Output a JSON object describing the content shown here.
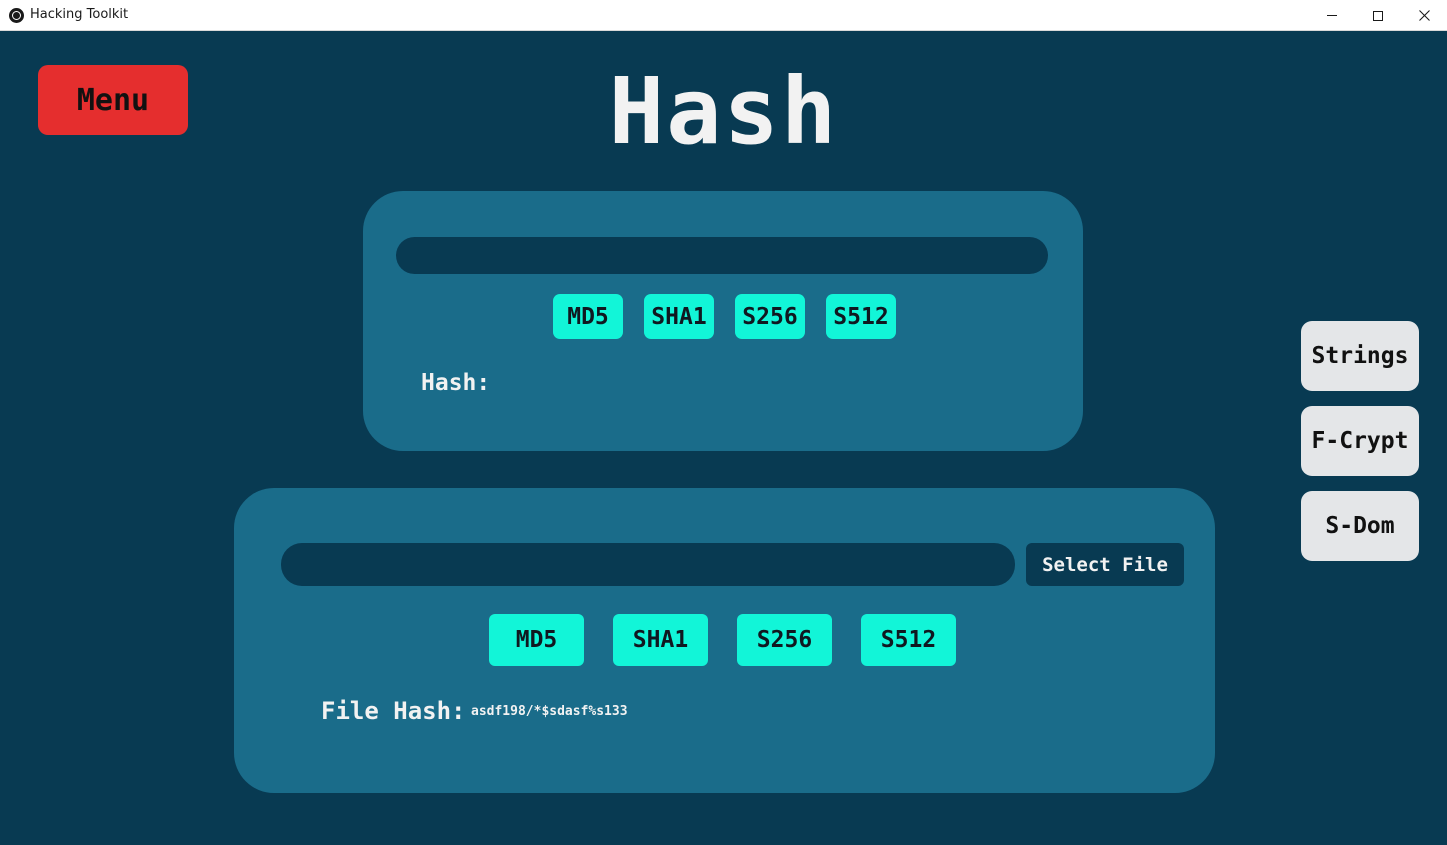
{
  "window": {
    "title": "Hacking Toolkit",
    "app_icon": "app-icon",
    "controls": [
      "minimize",
      "maximize",
      "close"
    ]
  },
  "colors": {
    "background": "#083a52",
    "panel": "#1a6c8a",
    "accent_button": "#12f5d8",
    "menu_button": "#e52e2e",
    "side_button": "#e4e6e8"
  },
  "header": {
    "menu_label": "Menu",
    "title": "Hash"
  },
  "text_hash": {
    "input_value": "",
    "buttons": [
      "MD5",
      "SHA1",
      "S256",
      "S512"
    ],
    "result_label": "Hash:",
    "result_value": ""
  },
  "file_hash": {
    "input_value": "",
    "select_label": "Select File",
    "buttons": [
      "MD5",
      "SHA1",
      "S256",
      "S512"
    ],
    "result_label": "File Hash:",
    "result_value": "asdf198/*$sdasf%s133"
  },
  "sidebar": {
    "items": [
      {
        "label": "Strings"
      },
      {
        "label": "F-Crypt"
      },
      {
        "label": "S-Dom"
      }
    ]
  }
}
